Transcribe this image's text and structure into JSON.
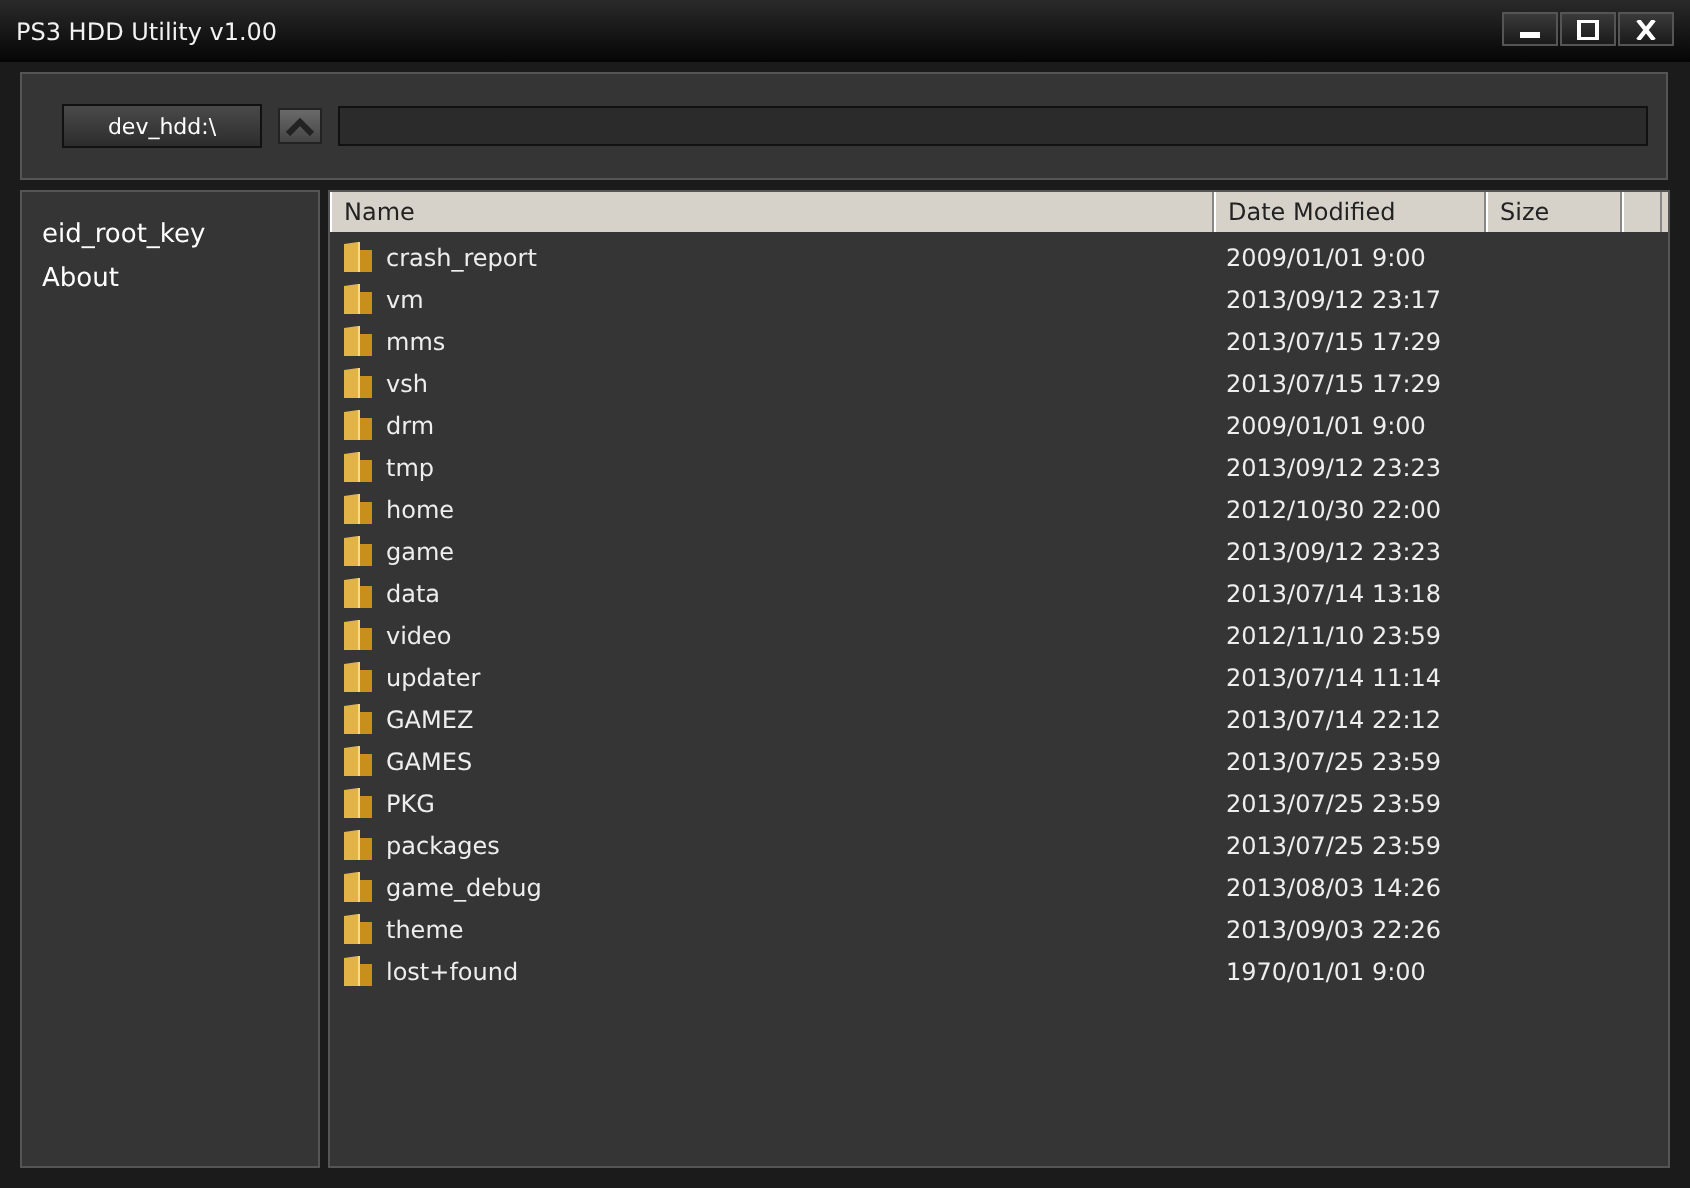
{
  "window": {
    "title": "PS3 HDD Utility v1.00"
  },
  "toolbar": {
    "drive_button": "dev_hdd:\\"
  },
  "sidebar": {
    "items": [
      {
        "label": "eid_root_key"
      },
      {
        "label": "About"
      }
    ]
  },
  "table": {
    "columns": [
      "Name",
      "Date Modified",
      "Size"
    ],
    "rows": [
      {
        "name": "crash_report",
        "date": "2009/01/01 9:00"
      },
      {
        "name": "vm",
        "date": "2013/09/12 23:17"
      },
      {
        "name": "mms",
        "date": "2013/07/15 17:29"
      },
      {
        "name": "vsh",
        "date": "2013/07/15 17:29"
      },
      {
        "name": "drm",
        "date": "2009/01/01 9:00"
      },
      {
        "name": "tmp",
        "date": "2013/09/12 23:23"
      },
      {
        "name": "home",
        "date": "2012/10/30 22:00"
      },
      {
        "name": "game",
        "date": "2013/09/12 23:23"
      },
      {
        "name": "data",
        "date": "2013/07/14 13:18"
      },
      {
        "name": "video",
        "date": "2012/11/10 23:59"
      },
      {
        "name": "updater",
        "date": "2013/07/14 11:14"
      },
      {
        "name": "GAMEZ",
        "date": "2013/07/14 22:12"
      },
      {
        "name": "GAMES",
        "date": "2013/07/25 23:59"
      },
      {
        "name": "PKG",
        "date": "2013/07/25 23:59"
      },
      {
        "name": "packages",
        "date": "2013/07/25 23:59"
      },
      {
        "name": "game_debug",
        "date": "2013/08/03 14:26"
      },
      {
        "name": "theme",
        "date": "2013/09/03 22:26"
      },
      {
        "name": "lost+found",
        "date": "1970/01/01 9:00"
      }
    ]
  }
}
